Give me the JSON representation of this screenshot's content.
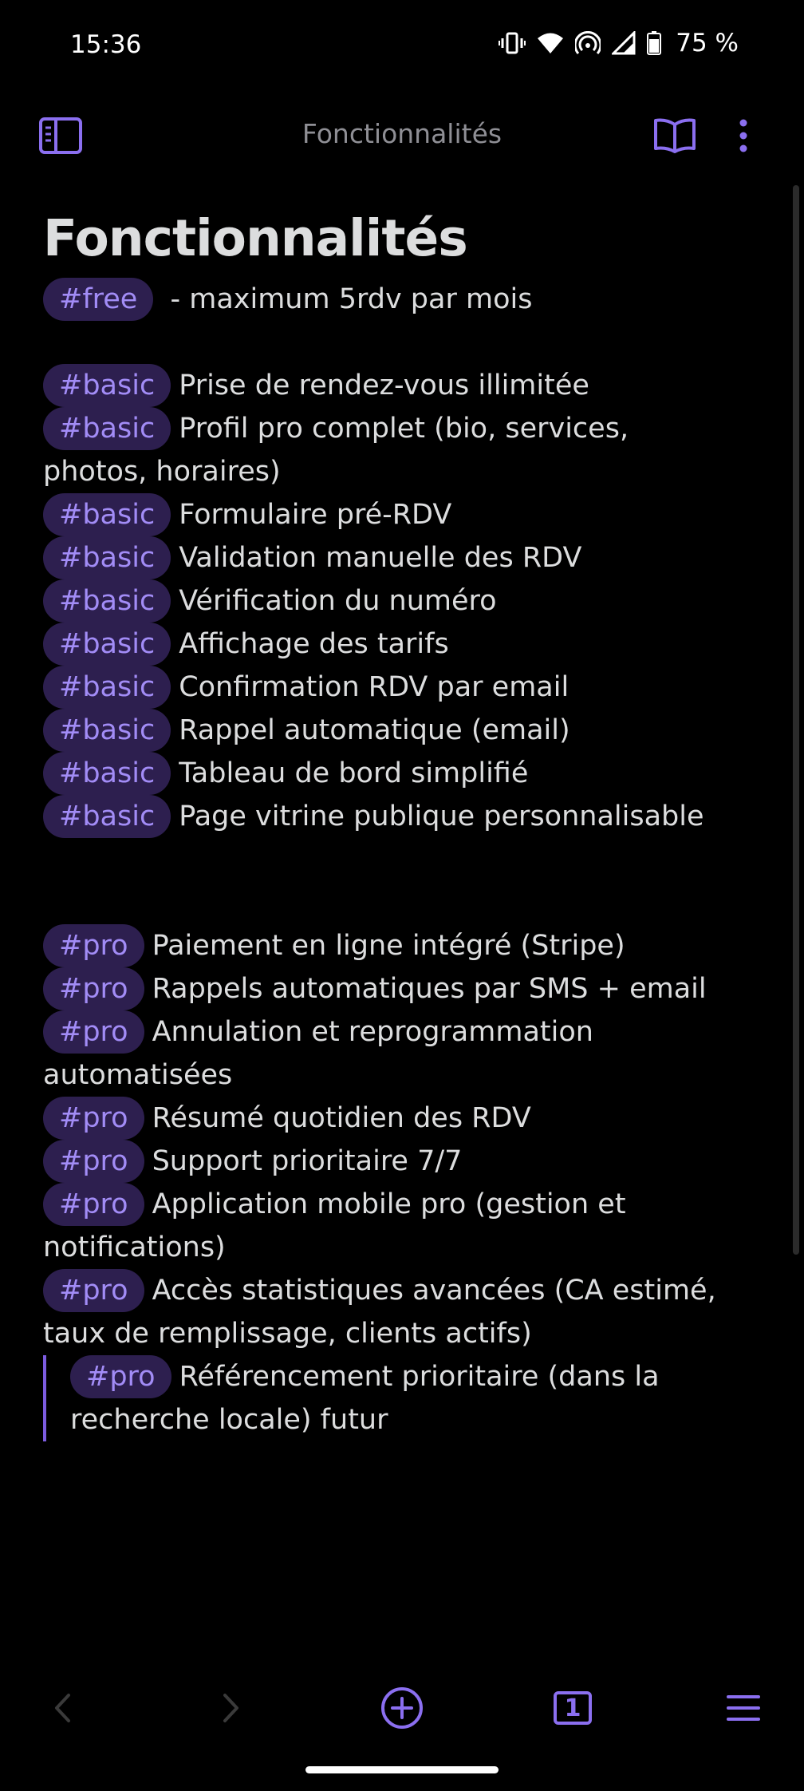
{
  "status": {
    "time": "15:36",
    "battery": "75 %"
  },
  "topbar": {
    "title": "Fonctionnalités"
  },
  "note": {
    "heading": "Fonctionnalités",
    "free": {
      "tag": "#free",
      "text": " - maximum 5rdv par mois"
    },
    "basic": [
      {
        "tag": "#basic",
        "text": "Prise de rendez-vous illimitée"
      },
      {
        "tag": "#basic",
        "text": "Profil pro complet (bio, services, photos, horaires)"
      },
      {
        "tag": "#basic",
        "text": "Formulaire pré-RDV"
      },
      {
        "tag": "#basic",
        "text": "Validation manuelle des RDV"
      },
      {
        "tag": "#basic",
        "text": "Vérification du numéro"
      },
      {
        "tag": "#basic",
        "text": "Affichage des tarifs"
      },
      {
        "tag": "#basic",
        "text": "Confirmation RDV par email"
      },
      {
        "tag": "#basic",
        "text": "Rappel automatique (email)"
      },
      {
        "tag": "#basic",
        "text": "Tableau de bord simplifié"
      },
      {
        "tag": "#basic",
        "text": "Page vitrine publique personnalisable"
      }
    ],
    "pro": [
      {
        "tag": "#pro",
        "text": "Paiement en ligne intégré (Stripe)"
      },
      {
        "tag": "#pro",
        "text": "Rappels automatiques par SMS + email"
      },
      {
        "tag": "#pro",
        "text": "Annulation et reprogrammation automatisées"
      },
      {
        "tag": "#pro",
        "text": "Résumé quotidien des RDV"
      },
      {
        "tag": "#pro",
        "text": "Support prioritaire 7/7"
      },
      {
        "tag": "#pro",
        "text": "Application mobile pro (gestion et notifications)"
      },
      {
        "tag": "#pro",
        "text": "Accès statistiques avancées (CA estimé, taux de remplissage, clients actifs)"
      }
    ],
    "quote": {
      "tag": "#pro",
      "text": "Référencement prioritaire (dans la recherche locale) futur"
    }
  },
  "bottombar": {
    "tab_count": "1"
  },
  "colors": {
    "accent": "#8b6ff0",
    "tag_bg": "#2d1f4f",
    "tag_text": "#a28cf6",
    "background": "#000000"
  },
  "icons": {
    "sidebar": "sidebar-toggle-icon",
    "reading": "book-open-icon",
    "more": "more-vertical-icon",
    "back": "chevron-left-icon",
    "forward": "chevron-right-icon",
    "new": "plus-circle-icon",
    "tabs": "tabs-icon",
    "menu": "hamburger-menu-icon"
  }
}
